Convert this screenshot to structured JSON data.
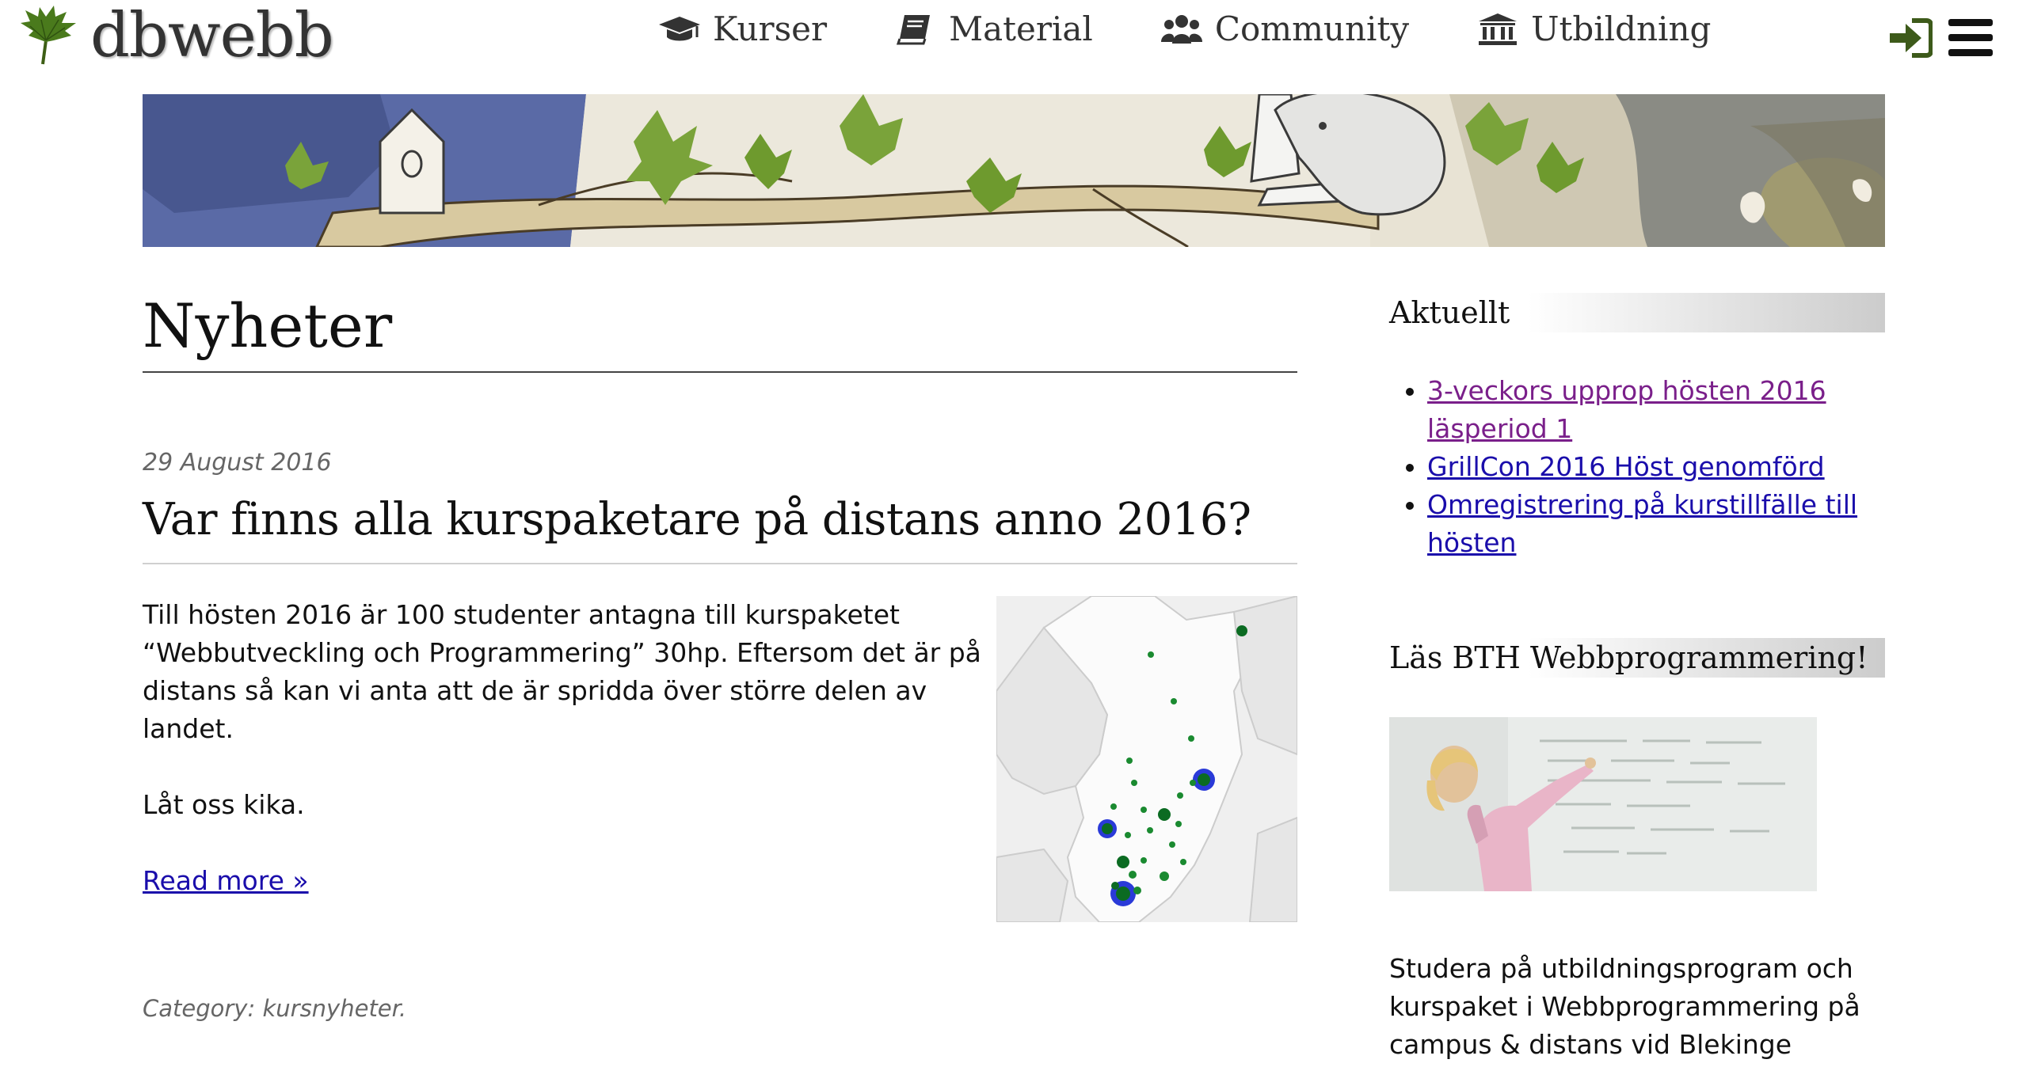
{
  "header": {
    "logo_text": "dbwebb",
    "nav": [
      {
        "label": "Kurser",
        "icon": "graduation-cap-icon"
      },
      {
        "label": "Material",
        "icon": "book-icon"
      },
      {
        "label": "Community",
        "icon": "users-icon"
      },
      {
        "label": "Utbildning",
        "icon": "university-icon"
      }
    ],
    "login_icon": "sign-in-icon",
    "menu_icon": "hamburger-menu-icon"
  },
  "main": {
    "page_title": "Nyheter",
    "post": {
      "date": "29 August 2016",
      "title": "Var finns alla kurspaketare på distans anno 2016?",
      "paragraphs": [
        "Till hösten 2016 är 100 studenter antagna till kurspaketet “Webbutveckling och Programmering” 30hp. Eftersom det är på distans så kan vi anta att de är spridda över större delen av landet.",
        "Låt oss kika."
      ],
      "read_more": "Read more »",
      "category_label": "Category:",
      "category": "kursnyheter",
      "category_suffix": "."
    }
  },
  "sidebar": {
    "heading_1": "Aktuellt",
    "news": [
      {
        "label": "3-veckors upprop hösten 2016 läsperiod 1",
        "visited": true
      },
      {
        "label": "GrillCon 2016 Höst genomförd",
        "visited": false
      },
      {
        "label": "Omregistrering på kurstillfälle till hösten",
        "visited": false
      }
    ],
    "heading_2": "Läs BTH Webbprogrammering!",
    "promo_text": "Studera på utbildningsprogram och kurspaket i Webbprogrammering på campus & distans vid Blekinge"
  },
  "colors": {
    "link": "#1a0dab",
    "visited_link": "#7a1f8a",
    "logo_green": "#4a7a1c",
    "icon_dark": "#333333",
    "login_green": "#3d5a1a"
  }
}
